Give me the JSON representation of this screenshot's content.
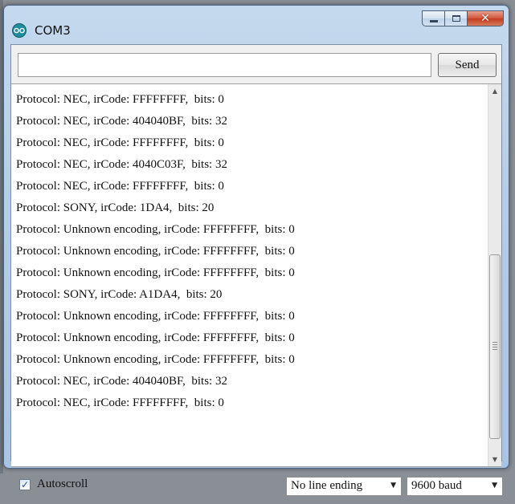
{
  "window": {
    "title": "COM3",
    "controls": {
      "close": "✕"
    }
  },
  "input": {
    "value": "",
    "placeholder": ""
  },
  "send_button": {
    "label": "Send"
  },
  "output": {
    "lines": [
      "Protocol: NEC, irCode: FFFFFFFF,  bits: 0",
      "Protocol: NEC, irCode: 404040BF,  bits: 32",
      "Protocol: NEC, irCode: FFFFFFFF,  bits: 0",
      "Protocol: NEC, irCode: 4040C03F,  bits: 32",
      "Protocol: NEC, irCode: FFFFFFFF,  bits: 0",
      "Protocol: SONY, irCode: 1DA4,  bits: 20",
      "Protocol: Unknown encoding, irCode: FFFFFFFF,  bits: 0",
      "Protocol: Unknown encoding, irCode: FFFFFFFF,  bits: 0",
      "Protocol: Unknown encoding, irCode: FFFFFFFF,  bits: 0",
      "Protocol: SONY, irCode: A1DA4,  bits: 20",
      "Protocol: Unknown encoding, irCode: FFFFFFFF,  bits: 0",
      "Protocol: Unknown encoding, irCode: FFFFFFFF,  bits: 0",
      "Protocol: Unknown encoding, irCode: FFFFFFFF,  bits: 0",
      "Protocol: NEC, irCode: 404040BF,  bits: 32",
      "Protocol: NEC, irCode: FFFFFFFF,  bits: 0"
    ]
  },
  "footer": {
    "autoscroll_label": "Autoscroll",
    "autoscroll_checked": true,
    "line_ending": "No line ending",
    "baud_rate": "9600 baud"
  },
  "colors": {
    "title_bar": "#b5cde6",
    "close_button": "#c43b1e",
    "app_icon": "#1d8f9c"
  },
  "icons": [
    "arduino-icon",
    "minimize-icon",
    "maximize-icon",
    "close-icon",
    "checkmark-icon",
    "chevron-down-icon",
    "scroll-up-icon",
    "scroll-down-icon"
  ]
}
